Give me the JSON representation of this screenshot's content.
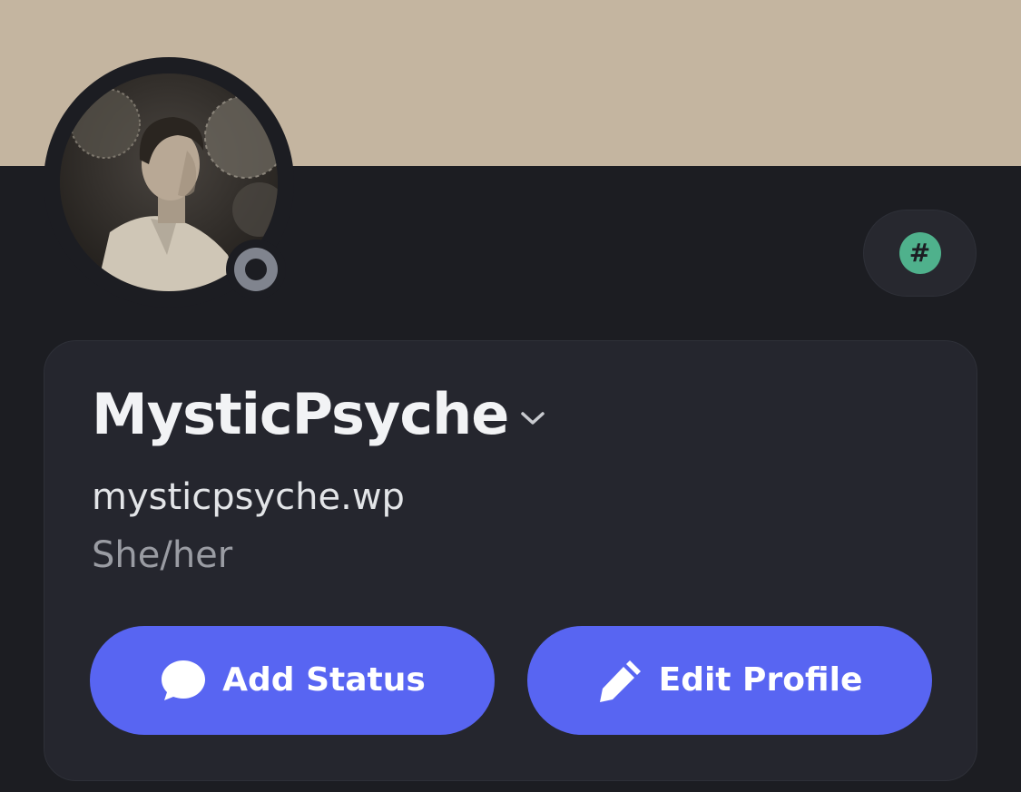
{
  "profile": {
    "display_name": "MysticPsyche",
    "username": "mysticpsyche.wp",
    "pronouns": "She/her",
    "presence": "offline",
    "banner_color": "#c4b5a0"
  },
  "badge": {
    "icon": "hashtag-icon",
    "glyph": "#",
    "color": "#4fb18c"
  },
  "actions": {
    "add_status_label": "Add Status",
    "add_status_icon": "chat-bubble-icon",
    "edit_profile_label": "Edit Profile",
    "edit_profile_icon": "pencil-icon",
    "accent": "#5865f2"
  }
}
